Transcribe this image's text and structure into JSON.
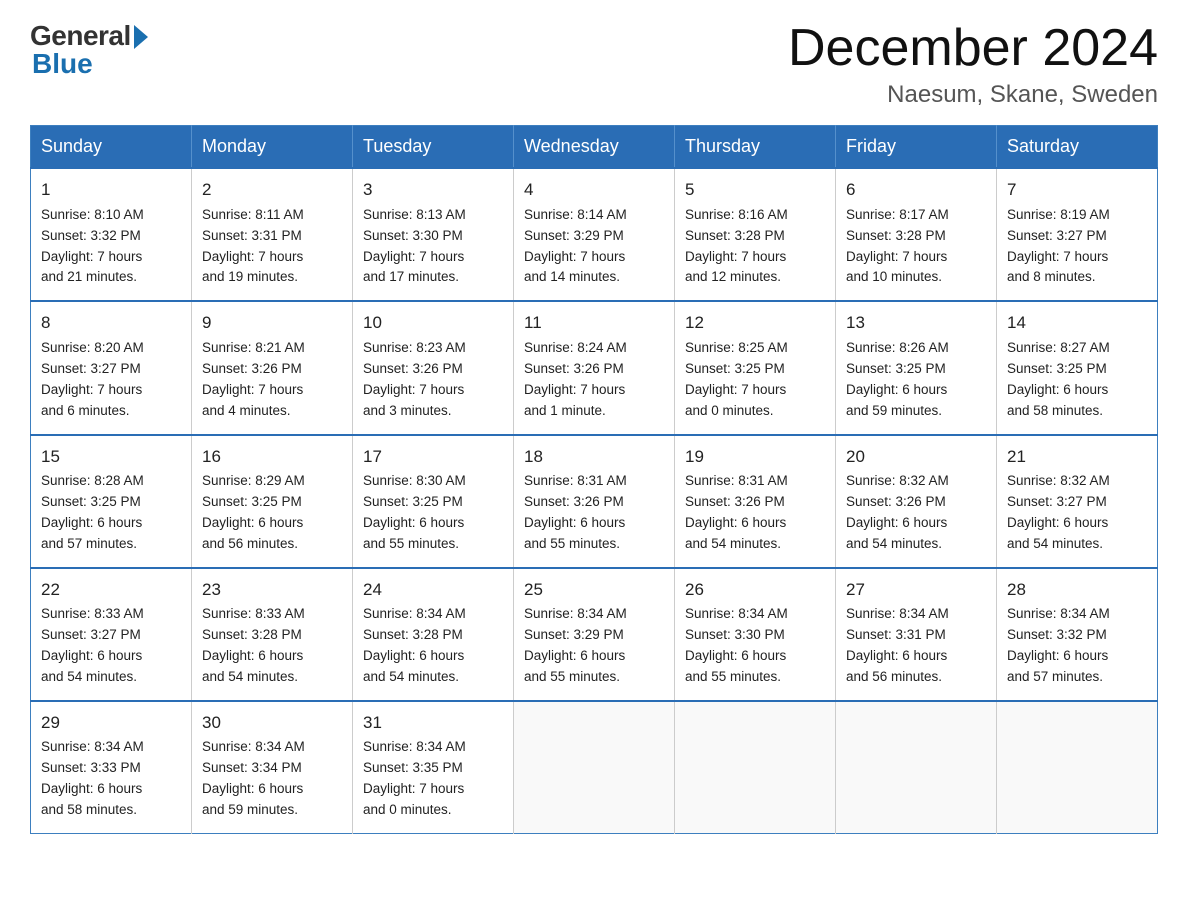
{
  "header": {
    "logo_general": "General",
    "logo_blue": "Blue",
    "month_title": "December 2024",
    "location": "Naesum, Skane, Sweden"
  },
  "weekdays": [
    "Sunday",
    "Monday",
    "Tuesday",
    "Wednesday",
    "Thursday",
    "Friday",
    "Saturday"
  ],
  "weeks": [
    [
      {
        "day": "1",
        "info": "Sunrise: 8:10 AM\nSunset: 3:32 PM\nDaylight: 7 hours\nand 21 minutes."
      },
      {
        "day": "2",
        "info": "Sunrise: 8:11 AM\nSunset: 3:31 PM\nDaylight: 7 hours\nand 19 minutes."
      },
      {
        "day": "3",
        "info": "Sunrise: 8:13 AM\nSunset: 3:30 PM\nDaylight: 7 hours\nand 17 minutes."
      },
      {
        "day": "4",
        "info": "Sunrise: 8:14 AM\nSunset: 3:29 PM\nDaylight: 7 hours\nand 14 minutes."
      },
      {
        "day": "5",
        "info": "Sunrise: 8:16 AM\nSunset: 3:28 PM\nDaylight: 7 hours\nand 12 minutes."
      },
      {
        "day": "6",
        "info": "Sunrise: 8:17 AM\nSunset: 3:28 PM\nDaylight: 7 hours\nand 10 minutes."
      },
      {
        "day": "7",
        "info": "Sunrise: 8:19 AM\nSunset: 3:27 PM\nDaylight: 7 hours\nand 8 minutes."
      }
    ],
    [
      {
        "day": "8",
        "info": "Sunrise: 8:20 AM\nSunset: 3:27 PM\nDaylight: 7 hours\nand 6 minutes."
      },
      {
        "day": "9",
        "info": "Sunrise: 8:21 AM\nSunset: 3:26 PM\nDaylight: 7 hours\nand 4 minutes."
      },
      {
        "day": "10",
        "info": "Sunrise: 8:23 AM\nSunset: 3:26 PM\nDaylight: 7 hours\nand 3 minutes."
      },
      {
        "day": "11",
        "info": "Sunrise: 8:24 AM\nSunset: 3:26 PM\nDaylight: 7 hours\nand 1 minute."
      },
      {
        "day": "12",
        "info": "Sunrise: 8:25 AM\nSunset: 3:25 PM\nDaylight: 7 hours\nand 0 minutes."
      },
      {
        "day": "13",
        "info": "Sunrise: 8:26 AM\nSunset: 3:25 PM\nDaylight: 6 hours\nand 59 minutes."
      },
      {
        "day": "14",
        "info": "Sunrise: 8:27 AM\nSunset: 3:25 PM\nDaylight: 6 hours\nand 58 minutes."
      }
    ],
    [
      {
        "day": "15",
        "info": "Sunrise: 8:28 AM\nSunset: 3:25 PM\nDaylight: 6 hours\nand 57 minutes."
      },
      {
        "day": "16",
        "info": "Sunrise: 8:29 AM\nSunset: 3:25 PM\nDaylight: 6 hours\nand 56 minutes."
      },
      {
        "day": "17",
        "info": "Sunrise: 8:30 AM\nSunset: 3:25 PM\nDaylight: 6 hours\nand 55 minutes."
      },
      {
        "day": "18",
        "info": "Sunrise: 8:31 AM\nSunset: 3:26 PM\nDaylight: 6 hours\nand 55 minutes."
      },
      {
        "day": "19",
        "info": "Sunrise: 8:31 AM\nSunset: 3:26 PM\nDaylight: 6 hours\nand 54 minutes."
      },
      {
        "day": "20",
        "info": "Sunrise: 8:32 AM\nSunset: 3:26 PM\nDaylight: 6 hours\nand 54 minutes."
      },
      {
        "day": "21",
        "info": "Sunrise: 8:32 AM\nSunset: 3:27 PM\nDaylight: 6 hours\nand 54 minutes."
      }
    ],
    [
      {
        "day": "22",
        "info": "Sunrise: 8:33 AM\nSunset: 3:27 PM\nDaylight: 6 hours\nand 54 minutes."
      },
      {
        "day": "23",
        "info": "Sunrise: 8:33 AM\nSunset: 3:28 PM\nDaylight: 6 hours\nand 54 minutes."
      },
      {
        "day": "24",
        "info": "Sunrise: 8:34 AM\nSunset: 3:28 PM\nDaylight: 6 hours\nand 54 minutes."
      },
      {
        "day": "25",
        "info": "Sunrise: 8:34 AM\nSunset: 3:29 PM\nDaylight: 6 hours\nand 55 minutes."
      },
      {
        "day": "26",
        "info": "Sunrise: 8:34 AM\nSunset: 3:30 PM\nDaylight: 6 hours\nand 55 minutes."
      },
      {
        "day": "27",
        "info": "Sunrise: 8:34 AM\nSunset: 3:31 PM\nDaylight: 6 hours\nand 56 minutes."
      },
      {
        "day": "28",
        "info": "Sunrise: 8:34 AM\nSunset: 3:32 PM\nDaylight: 6 hours\nand 57 minutes."
      }
    ],
    [
      {
        "day": "29",
        "info": "Sunrise: 8:34 AM\nSunset: 3:33 PM\nDaylight: 6 hours\nand 58 minutes."
      },
      {
        "day": "30",
        "info": "Sunrise: 8:34 AM\nSunset: 3:34 PM\nDaylight: 6 hours\nand 59 minutes."
      },
      {
        "day": "31",
        "info": "Sunrise: 8:34 AM\nSunset: 3:35 PM\nDaylight: 7 hours\nand 0 minutes."
      },
      {
        "day": "",
        "info": ""
      },
      {
        "day": "",
        "info": ""
      },
      {
        "day": "",
        "info": ""
      },
      {
        "day": "",
        "info": ""
      }
    ]
  ]
}
